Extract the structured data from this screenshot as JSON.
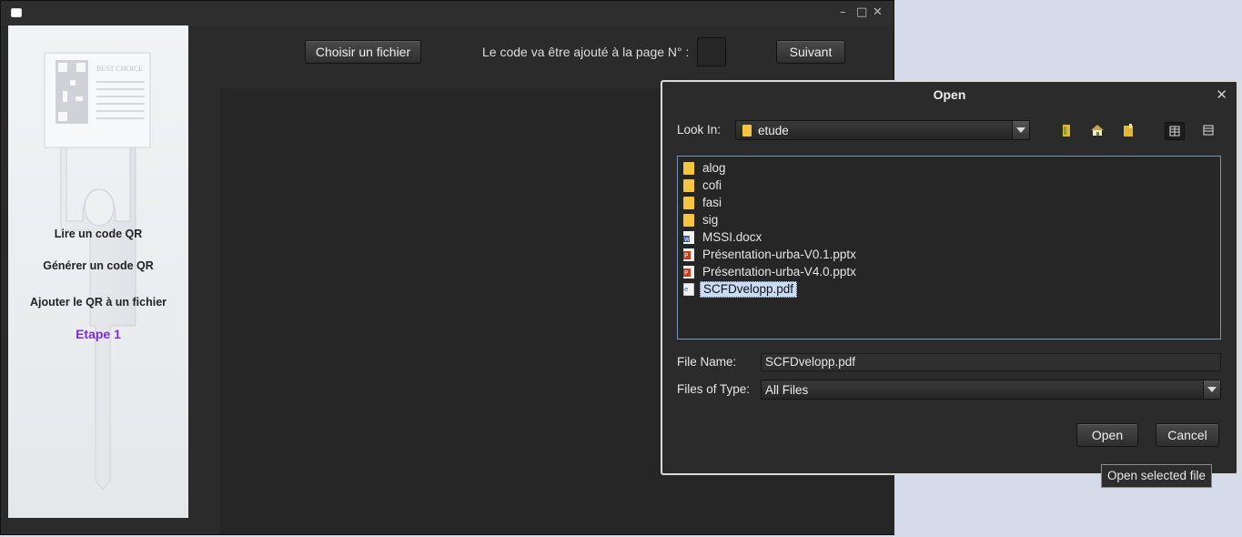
{
  "main_window": {
    "sidebar": {
      "items": [
        {
          "label": "Lire un code QR"
        },
        {
          "label": "Générer un code QR"
        },
        {
          "label": "Ajouter le QR à un fichier"
        }
      ],
      "step_label": "Etape 1",
      "poster_text": "BEST CHOICE"
    },
    "toolbar": {
      "choose_file_label": "Choisir un fichier",
      "page_label": "Le code va être ajouté à la page N° :",
      "page_value": "",
      "next_label": "Suivant"
    }
  },
  "dialog": {
    "title": "Open",
    "look_in_label": "Look In:",
    "look_in_value": "etude",
    "files": [
      {
        "name": "alog",
        "icon": "folder-icon"
      },
      {
        "name": "cofi",
        "icon": "folder-icon"
      },
      {
        "name": "fasi",
        "icon": "folder-icon"
      },
      {
        "name": "sig",
        "icon": "folder-icon"
      },
      {
        "name": "MSSI.docx",
        "icon": "word-doc-icon"
      },
      {
        "name": "Présentation-urba-V0.1.pptx",
        "icon": "powerpoint-icon"
      },
      {
        "name": "Présentation-urba-V4.0.pptx",
        "icon": "powerpoint-icon"
      },
      {
        "name": "SCFDvelopp.pdf",
        "icon": "pdf-file-icon",
        "selected": true
      }
    ],
    "file_name_label": "File Name:",
    "file_name_value": "SCFDvelopp.pdf",
    "files_of_type_label": "Files of Type:",
    "files_of_type_value": "All Files",
    "open_label": "Open",
    "cancel_label": "Cancel"
  },
  "tooltip": "Open selected file",
  "colors": {
    "window_bg": "#2b2b2b",
    "step_accent": "#7a2fd0",
    "selection_bg": "#c9dcf4",
    "desktop_bg": "#d6dbe9"
  }
}
